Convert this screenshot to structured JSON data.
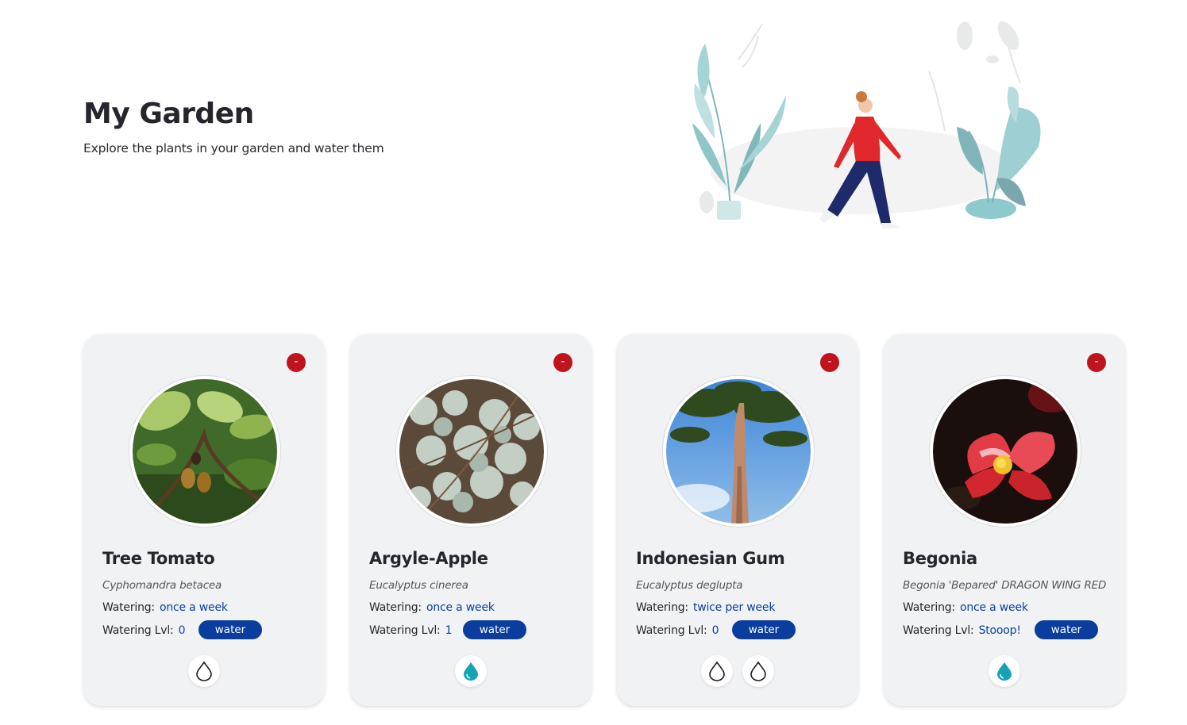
{
  "header": {
    "title": "My Garden",
    "subtitle": "Explore the plants in your garden and water them"
  },
  "hero": {
    "icon": "woman-walking-with-plants-illustration"
  },
  "labels": {
    "watering": "Watering:",
    "level": "Watering Lvl:",
    "water_button": "water",
    "remove_button": "-"
  },
  "colors": {
    "remove": "#c0141c",
    "water_button": "#0a3d9e",
    "value_text": "#0a3fa8",
    "drop_filled": "#15a2b4",
    "card_bg": "#f1f2f4"
  },
  "plants": [
    {
      "name": "Tree Tomato",
      "scientific": "Cyphomandra betacea",
      "watering": "once a week",
      "level": "0",
      "drops": [
        "empty"
      ]
    },
    {
      "name": "Argyle-Apple",
      "scientific": "Eucalyptus cinerea",
      "watering": "once a week",
      "level": "1",
      "drops": [
        "filled"
      ]
    },
    {
      "name": "Indonesian Gum",
      "scientific": "Eucalyptus deglupta",
      "watering": "twice per week",
      "level": "0",
      "drops": [
        "empty",
        "empty"
      ]
    },
    {
      "name": "Begonia",
      "scientific": "Begonia 'Bepared' DRAGON WING RED",
      "watering": "once a week",
      "level": "Stooop!",
      "drops": [
        "filled"
      ]
    }
  ]
}
